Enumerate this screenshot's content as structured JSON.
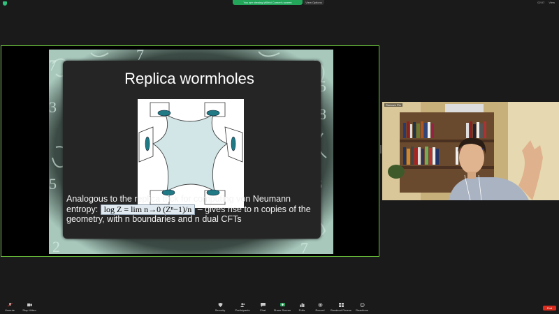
{
  "topbar": {
    "viewing_text": "You are viewing Wilfrid Comer's screen",
    "view_options": "View Options",
    "time": "02:07",
    "view_label": "View"
  },
  "slide": {
    "title": "Replica wormholes",
    "caption_1": "Analogous to the replica trick for computing von Neumann",
    "caption_2_pre": "entropy:",
    "formula": "log Z = lim n→0 (Zⁿ−1)/n",
    "caption_2_post": "– gives rise to n copies of the",
    "caption_3": "geometry, with n boundaries and n dual CFTs"
  },
  "video": {
    "name": "Remove Pin"
  },
  "toolbar": {
    "unmute": "Unmute",
    "stop_video": "Stop Video",
    "security": "Security",
    "participants": "Participants",
    "participants_count": "99",
    "chat": "Chat",
    "share_screen": "Share Screen",
    "polls": "Polls",
    "record": "Record",
    "breakout": "Breakout Rooms",
    "reactions": "Reactions",
    "end": "End"
  },
  "colors": {
    "accent_green": "#23a55a",
    "share_border": "#6ac23a",
    "end_red": "#d92d20"
  }
}
